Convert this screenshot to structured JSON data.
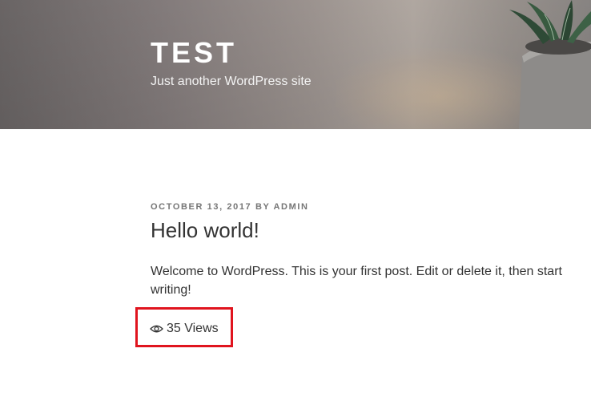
{
  "site": {
    "title": "TEST",
    "tagline": "Just another WordPress site"
  },
  "post": {
    "date": "OCTOBER 13, 2017",
    "by_label": "BY",
    "author": "ADMIN",
    "title": "Hello world!",
    "content": "Welcome to WordPress. This is your first post. Edit or delete it, then start writing!",
    "views_icon": "eye-icon",
    "views": "35 Views"
  },
  "colors": {
    "highlight_border": "#e0141e",
    "text": "#333333",
    "meta": "#767676"
  }
}
